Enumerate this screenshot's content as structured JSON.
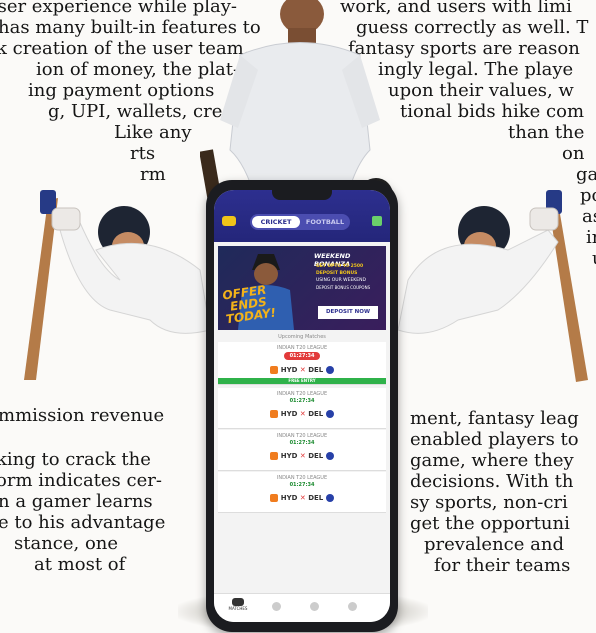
{
  "article": {
    "left_lines": [
      "user experience while play-",
      "has many built-in features to",
      "k creation of the user team.",
      "ion of money, the plat-",
      "ing payment options",
      "g, UPI, wallets, cred-",
      "Like any",
      "rts",
      "rm"
    ],
    "left_lower_lines": [
      "mmission revenue",
      "",
      "king to crack the",
      "orm indicates cer-",
      "n a gamer learns",
      "e to his advantage",
      "stance, one",
      "at most of"
    ],
    "right_lines": [
      "work, and users with limi",
      "guess correctly as well. T",
      "fantasy sports are reason",
      "ingly legal. The playe",
      "upon their values, w",
      "tional bids hike com",
      "than the",
      "on",
      "ga",
      "po",
      "as",
      "in",
      "u"
    ],
    "right_lower_lines": [
      "ment, fantasy leag",
      "enabled players to",
      "game, where they",
      "decisions. With th",
      "sy sports, non-cri",
      "get the opportuni",
      "prevalence and",
      "for their teams"
    ]
  },
  "app": {
    "tab_cricket": "CRICKET",
    "tab_football": "FOOTBALL",
    "banner": {
      "title": "WEEKEND BONANZA",
      "sub1": "GET UPTO ₹5 2500",
      "sub2": "DEPOSIT BONUS",
      "sub3": "USING OUR WEEKEND",
      "sub4": "DEPOSIT BONUS COUPONS",
      "offer1": "OFFER",
      "offer2": "ENDS",
      "offer3": "TODAY!",
      "cta": "DEPOSIT NOW"
    },
    "section_title": "Upcoming Matches",
    "free_entry": "FREE ENTRY",
    "matches": [
      {
        "league": "INDIAN T20 LEAGUE",
        "time": "01:27:34",
        "team1": "HYD",
        "team2": "DEL"
      },
      {
        "league": "INDIAN T20 LEAGUE",
        "time": "01:27:34",
        "team1": "HYD",
        "team2": "DEL"
      },
      {
        "league": "INDIAN T20 LEAGUE",
        "time": "01:27:34",
        "team1": "HYD",
        "team2": "DEL"
      },
      {
        "league": "INDIAN T20 LEAGUE",
        "time": "01:27:34",
        "team1": "HYD",
        "team2": "DEL"
      }
    ],
    "vs": "✕",
    "nav_home": "MATCHES"
  },
  "colors": {
    "app_bar": "#2d2f8f",
    "banner_accent": "#f0c419",
    "offer": "#f2b21a",
    "free_entry": "#2fb24a",
    "timer_red": "#e23a3a",
    "timer_green": "#1a8a2e"
  }
}
